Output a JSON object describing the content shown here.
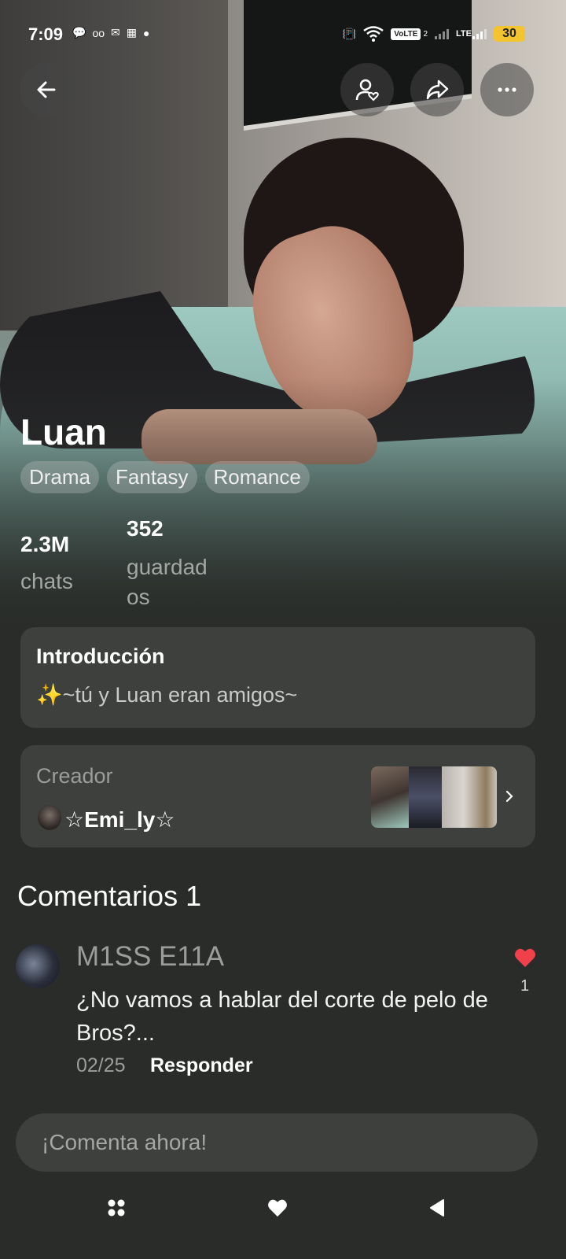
{
  "status_bar": {
    "time": "7:09",
    "left_icons": [
      "chat-bubble-icon",
      "voicemail-icon",
      "message-icon",
      "app-notification-icon",
      "dot-icon"
    ],
    "volte": "VoLTE",
    "volte_sim": "2",
    "lte": "LTE",
    "battery": "30"
  },
  "header": {
    "back_icon": "arrow-left-icon",
    "follow_icon": "user-heart-icon",
    "share_icon": "share-icon",
    "more_icon": "more-dots-icon"
  },
  "profile": {
    "name": "Luan",
    "tags": [
      "Drama",
      "Fantasy",
      "Romance"
    ],
    "stats": {
      "chats_value": "2.3M",
      "chats_label": "chats",
      "saved_value": "352",
      "saved_label_line1": "guardad",
      "saved_label_line2": "os"
    }
  },
  "intro": {
    "title": "Introducción",
    "text": "✨~tú y Luan eran amigos~"
  },
  "creator": {
    "label": "Creador",
    "name": "☆Emi_ly☆"
  },
  "comments": {
    "heading": "Comentarios 1",
    "items": [
      {
        "author": "M1SS E11A",
        "text": "¿No vamos a hablar del corte de pelo de Bros?...",
        "date": "02/25",
        "reply_label": "Responder",
        "likes": "1"
      }
    ]
  },
  "comment_input": {
    "placeholder": "¡Comenta ahora!"
  },
  "nav_bar": {
    "icons": [
      "apps-grid-icon",
      "heart-icon",
      "back-triangle-icon"
    ]
  },
  "colors": {
    "background": "#292c29",
    "card": "#3d403c",
    "like_red": "#f0404a",
    "battery": "#f4c430"
  }
}
